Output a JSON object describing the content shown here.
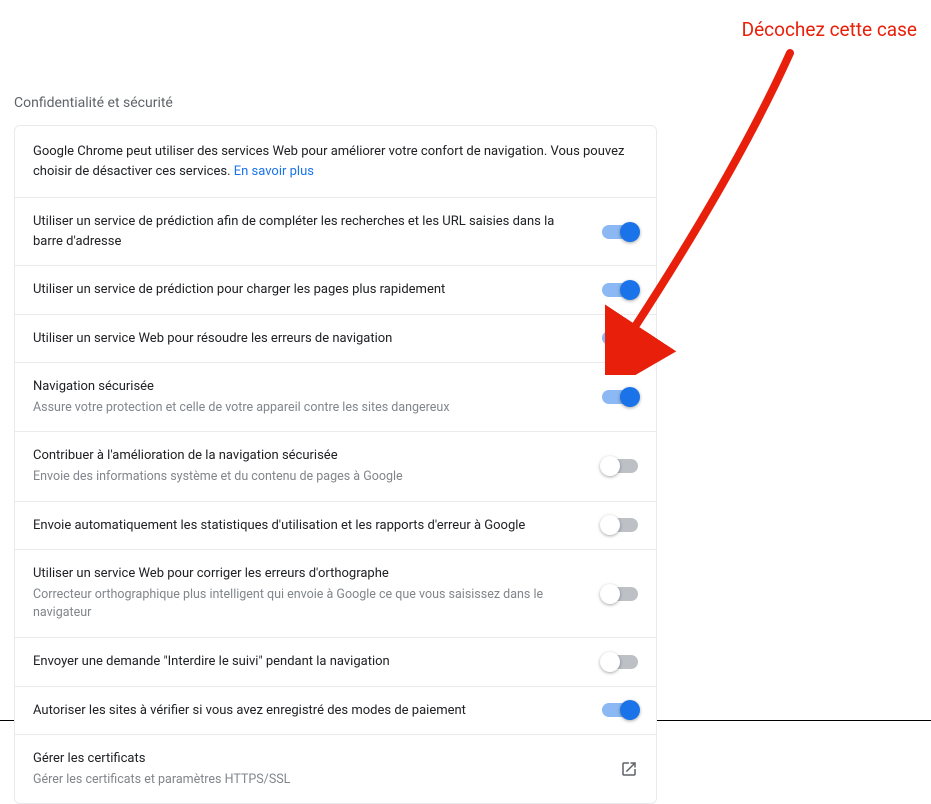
{
  "annotation": {
    "text": "Décochez cette case"
  },
  "section": {
    "title": "Confidentialité et sécurité"
  },
  "intro": {
    "text": "Google Chrome peut utiliser des services Web pour améliorer votre confort de navigation. Vous pouvez choisir de désactiver ces services.",
    "learn_more": "En savoir plus"
  },
  "settings": [
    {
      "title": "Utiliser un service de prédiction afin de compléter les recherches et les URL saisies dans la barre d'adresse",
      "sub": "",
      "toggle": true
    },
    {
      "title": "Utiliser un service de prédiction pour charger les pages plus rapidement",
      "sub": "",
      "toggle": true
    },
    {
      "title": "Utiliser un service Web pour résoudre les erreurs de navigation",
      "sub": "",
      "toggle": true
    },
    {
      "title": "Navigation sécurisée",
      "sub": "Assure votre protection et celle de votre appareil contre les sites dangereux",
      "toggle": true
    },
    {
      "title": "Contribuer à l'amélioration de la navigation sécurisée",
      "sub": "Envoie des informations système et du contenu de pages à Google",
      "toggle": false
    },
    {
      "title": "Envoie automatiquement les statistiques d'utilisation et les rapports d'erreur à Google",
      "sub": "",
      "toggle": false
    },
    {
      "title": "Utiliser un service Web pour corriger les erreurs d'orthographe",
      "sub": "Correcteur orthographique plus intelligent qui envoie à Google ce que vous saisissez dans le navigateur",
      "toggle": false
    },
    {
      "title": "Envoyer une demande \"Interdire le suivi\" pendant la navigation",
      "sub": "",
      "toggle": false
    },
    {
      "title": "Autoriser les sites à vérifier si vous avez enregistré des modes de paiement",
      "sub": "",
      "toggle": true
    }
  ],
  "certificates": {
    "title": "Gérer les certificats",
    "sub": "Gérer les certificats et paramètres HTTPS/SSL"
  }
}
